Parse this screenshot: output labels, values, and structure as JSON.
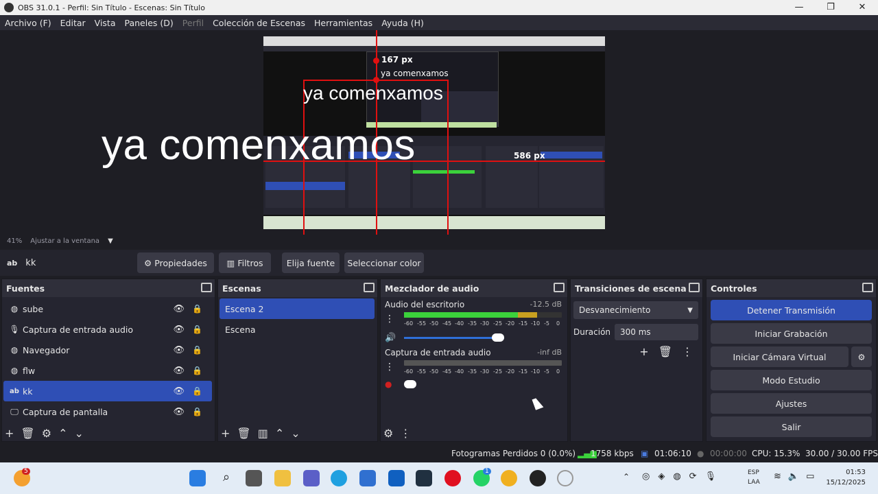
{
  "window": {
    "title": "OBS 31.0.1 - Perfil: Sin Título - Escenas: Sin Título",
    "minimize": "—",
    "maximize": "❐",
    "close": "✕"
  },
  "menu": [
    "Archivo (F)",
    "Editar",
    "Vista",
    "Paneles (D)",
    "Perfil",
    "Colección de Escenas",
    "Herramientas",
    "Ayuda (H)"
  ],
  "preview": {
    "big_text": "ya comenxamos",
    "mid_text": "ya comenxamos",
    "small_text": "ya comenxamos",
    "px_top": "167 px",
    "px_right": "586 px"
  },
  "zoom": {
    "value": "41%",
    "mode": "Ajustar a la ventana"
  },
  "sourcebar": {
    "selected_source": "kk",
    "properties": "Propiedades",
    "filters": "Filtros",
    "choose_font": "Elija fuente",
    "select_color": "Seleccionar color"
  },
  "sources": {
    "title": "Fuentes",
    "items": [
      {
        "name": "sube",
        "icon": "browser-icon"
      },
      {
        "name": "Captura de entrada audio",
        "icon": "microphone-icon"
      },
      {
        "name": "Navegador",
        "icon": "browser-icon"
      },
      {
        "name": "flw",
        "icon": "browser-icon"
      },
      {
        "name": "kk",
        "icon": "text-icon",
        "selected": true
      },
      {
        "name": "Captura de pantalla",
        "icon": "monitor-icon"
      }
    ]
  },
  "scenes": {
    "title": "Escenas",
    "items": [
      {
        "name": "Escena 2",
        "selected": true
      },
      {
        "name": "Escena"
      }
    ]
  },
  "mixer": {
    "title": "Mezclador de audio",
    "channels": [
      {
        "name": "Audio del escritorio",
        "level": "-12.5 dB",
        "fill": 0.72,
        "volume": 0.9
      },
      {
        "name": "Captura de entrada audio",
        "level": "-inf dB",
        "fill": 0.0,
        "volume": 0.05,
        "muted": true
      }
    ],
    "ticks": [
      "-60",
      "-55",
      "-50",
      "-45",
      "-40",
      "-35",
      "-30",
      "-25",
      "-20",
      "-15",
      "-10",
      "-5",
      "0"
    ]
  },
  "transitions": {
    "title": "Transiciones de escena",
    "selected": "Desvanecimiento",
    "duration_label": "Duración",
    "duration_value": "300 ms"
  },
  "controls": {
    "title": "Controles",
    "buttons": [
      "Detener Transmisión",
      "Iniciar Grabación",
      "Iniciar Cámara Virtual",
      "Modo Estudio",
      "Ajustes",
      "Salir"
    ]
  },
  "status": {
    "dropped": "Fotogramas Perdidos 0 (0.0%)",
    "bitrate": "1758 kbps",
    "stream_time": "01:06:10",
    "rec_time": "00:00:00",
    "cpu": "CPU: 15.3%",
    "fps": "30.00 / 30.00 FPS"
  },
  "taskbar": {
    "weather_badge": "5",
    "lang1": "ESP",
    "lang2": "LAA",
    "time": "01:53",
    "date": "15/12/2025",
    "whatsapp_badge": "1"
  },
  "colors": {
    "accent": "#2f4fb5",
    "panel": "#252530",
    "red": "#e01010",
    "meter_green": "#3bd13b"
  }
}
